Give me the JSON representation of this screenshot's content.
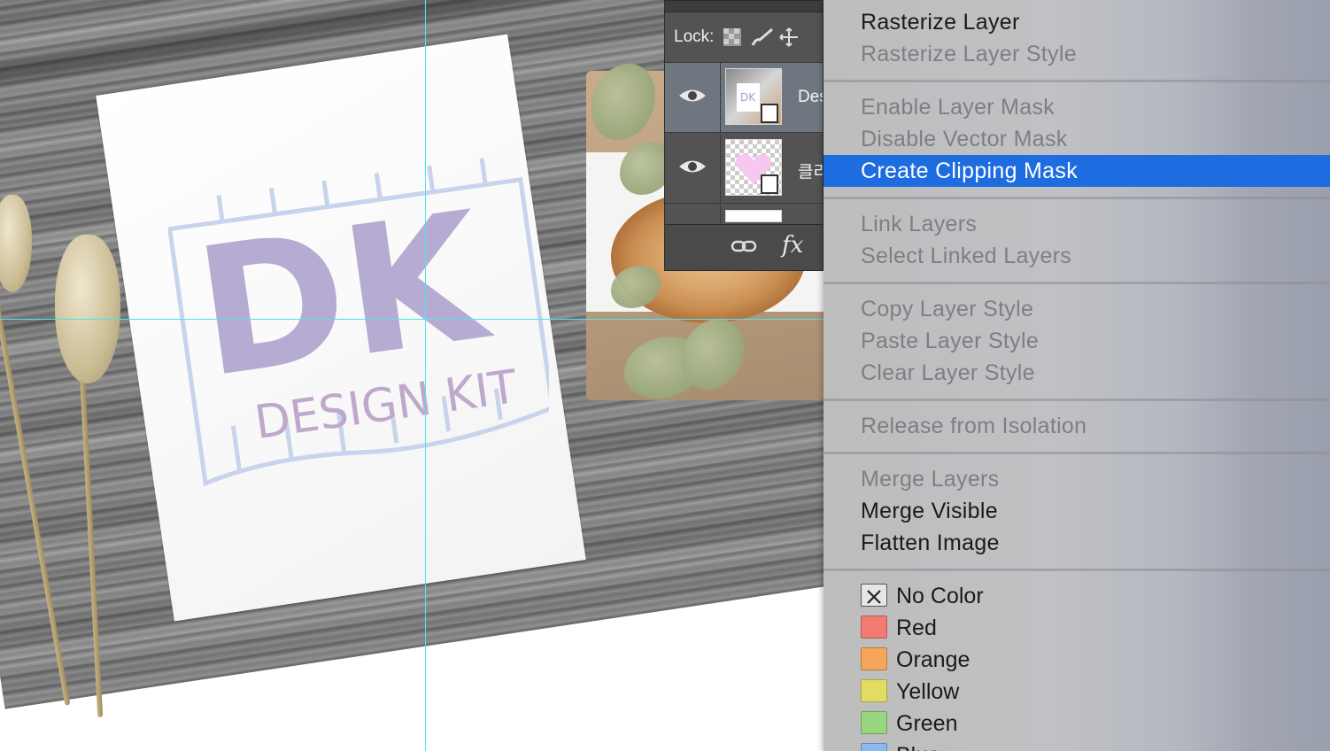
{
  "canvas": {
    "logo_top_text": "DK",
    "logo_bottom_text": "DESIGN KIT"
  },
  "layers_panel": {
    "lock_label": "Lock:",
    "layers": [
      {
        "name": "Des",
        "selected": true,
        "visible": true
      },
      {
        "name": "클리",
        "selected": false,
        "visible": true
      },
      {
        "name": "",
        "selected": false,
        "visible": false
      }
    ],
    "footer_icons": [
      "link-icon",
      "fx-icon"
    ],
    "fx_label": "fx"
  },
  "context_menu": {
    "groups": [
      [
        {
          "label": "Rasterize Layer",
          "enabled": true
        },
        {
          "label": "Rasterize Layer Style",
          "enabled": false
        }
      ],
      [
        {
          "label": "Enable Layer Mask",
          "enabled": false
        },
        {
          "label": "Disable Vector Mask",
          "enabled": false
        },
        {
          "label": "Create Clipping Mask",
          "enabled": true,
          "highlighted": true
        }
      ],
      [
        {
          "label": "Link Layers",
          "enabled": false
        },
        {
          "label": "Select Linked Layers",
          "enabled": false
        }
      ],
      [
        {
          "label": "Copy Layer Style",
          "enabled": false
        },
        {
          "label": "Paste Layer Style",
          "enabled": false
        },
        {
          "label": "Clear Layer Style",
          "enabled": false
        }
      ],
      [
        {
          "label": "Release from Isolation",
          "enabled": false
        }
      ],
      [
        {
          "label": "Merge Layers",
          "enabled": false
        },
        {
          "label": "Merge Visible",
          "enabled": true
        },
        {
          "label": "Flatten Image",
          "enabled": true
        }
      ]
    ],
    "colors": [
      {
        "label": "No Color",
        "swatch": "none"
      },
      {
        "label": "Red",
        "swatch": "#f27a72"
      },
      {
        "label": "Orange",
        "swatch": "#f5a65b"
      },
      {
        "label": "Yellow",
        "swatch": "#e4db63"
      },
      {
        "label": "Green",
        "swatch": "#97d67f"
      },
      {
        "label": "Blue",
        "swatch": "#8ab8f0"
      }
    ],
    "highlight_color": "#1d6ce0"
  }
}
